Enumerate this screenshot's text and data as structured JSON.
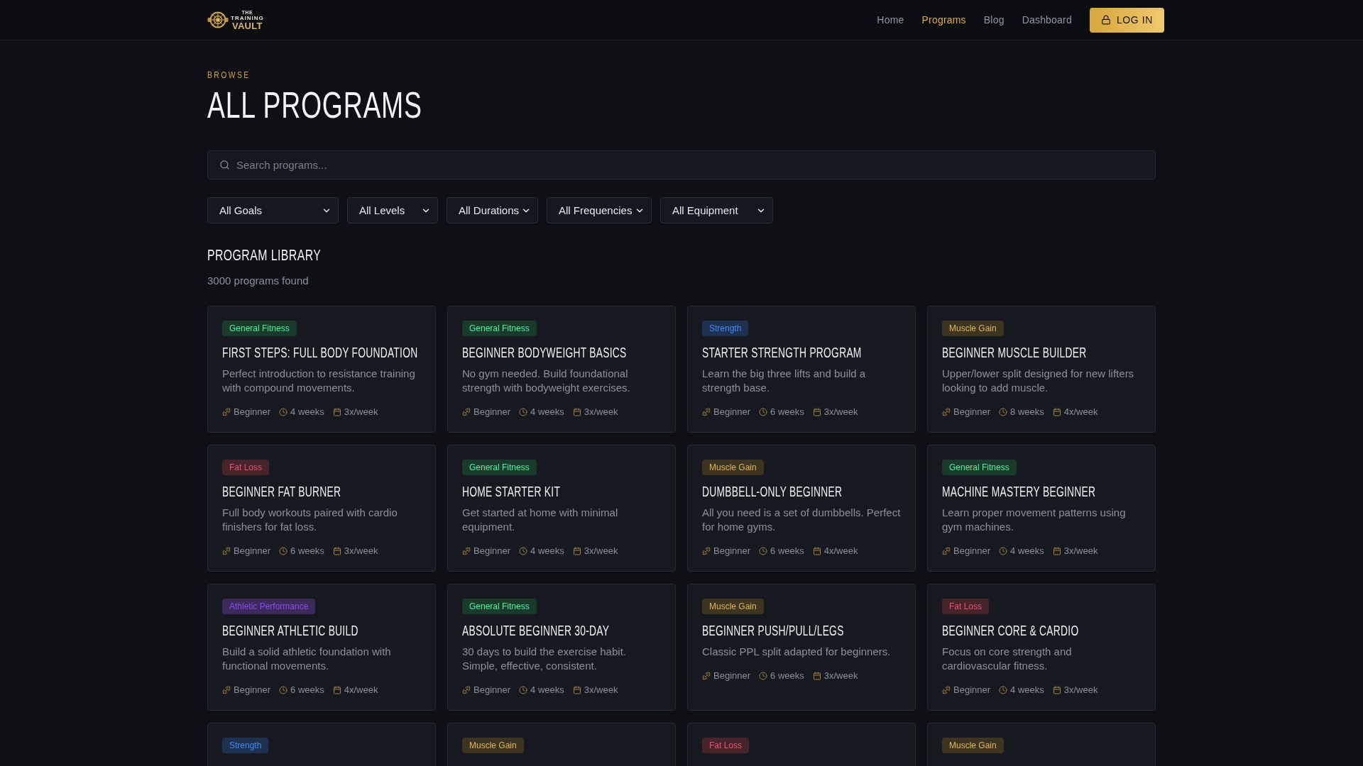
{
  "header": {
    "logo": {
      "line_1": "THE",
      "line_2": "TRAINING",
      "line_3": "VAULT"
    },
    "nav": [
      {
        "label": "Home",
        "selected": false
      },
      {
        "label": "Programs",
        "selected": true
      },
      {
        "label": "Blog",
        "selected": false
      },
      {
        "label": "Dashboard",
        "selected": false
      }
    ],
    "login_button": "LOG IN"
  },
  "page": {
    "eyebrow": "BROWSE",
    "title": "ALL PROGRAMS"
  },
  "search": {
    "placeholder": "Search programs..."
  },
  "filters": [
    "All Goals",
    "All Levels",
    "All Durations",
    "All Frequencies",
    "All Equipment"
  ],
  "library": {
    "heading": "PROGRAM LIBRARY",
    "count": "3000 programs found"
  },
  "cards": [
    {
      "tag": {
        "label": "General Fitness",
        "color": "#1a3b2b"
      },
      "title": "FIRST STEPS: FULL BODY FOUNDATION",
      "description": [
        "Perfect introduction to resistance training",
        "with compound movements."
      ],
      "difficulty": "Beginner",
      "duration": "4 weeks",
      "frequency": "3x/week"
    },
    {
      "tag": {
        "label": "General Fitness",
        "color": "#1a3b2b"
      },
      "title": "BEGINNER BODYWEIGHT BASICS",
      "description": [
        "No gym needed. Build foundational",
        "strength with bodyweight exercises."
      ],
      "difficulty": "Beginner",
      "duration": "4 weeks",
      "frequency": "3x/week"
    },
    {
      "tag": {
        "label": "Strength",
        "color": "#1e3150"
      },
      "title": "STARTER STRENGTH PROGRAM",
      "description": [
        "Learn the big three lifts and build a",
        "strength base."
      ],
      "difficulty": "Beginner",
      "duration": "6 weeks",
      "frequency": "3x/week"
    },
    {
      "tag": {
        "label": "Muscle Gain",
        "color": "#3d3421"
      },
      "title": "BEGINNER MUSCLE BUILDER",
      "description": [
        "Upper/lower split designed for new lifters",
        "looking to add muscle."
      ],
      "difficulty": "Beginner",
      "duration": "8 weeks",
      "frequency": "4x/week"
    },
    {
      "tag": {
        "label": "Fat Loss",
        "color": "#47242a"
      },
      "title": "BEGINNER FAT BURNER",
      "description": [
        "Full body workouts paired with cardio",
        "finishers for fat loss."
      ],
      "difficulty": "Beginner",
      "duration": "6 weeks",
      "frequency": "3x/week"
    },
    {
      "tag": {
        "label": "General Fitness",
        "color": "#1a3b2b"
      },
      "title": "HOME STARTER KIT",
      "description": [
        "Get started at home with minimal",
        "equipment."
      ],
      "difficulty": "Beginner",
      "duration": "4 weeks",
      "frequency": "3x/week"
    },
    {
      "tag": {
        "label": "Muscle Gain",
        "color": "#3d3421"
      },
      "title": "DUMBBELL-ONLY BEGINNER",
      "description": [
        "All you need is a set of dumbbells. Perfect",
        "for home gyms."
      ],
      "difficulty": "Beginner",
      "duration": "6 weeks",
      "frequency": "4x/week"
    },
    {
      "tag": {
        "label": "General Fitness",
        "color": "#1a3b2b"
      },
      "title": "MACHINE MASTERY BEGINNER",
      "description": [
        "Learn proper movement patterns using",
        "gym machines."
      ],
      "difficulty": "Beginner",
      "duration": "4 weeks",
      "frequency": "3x/week"
    },
    {
      "tag": {
        "label": "Athletic Performance",
        "color": "#3b2a5a"
      },
      "title": "BEGINNER ATHLETIC BUILD",
      "description": [
        "Build a solid athletic foundation with",
        "functional movements."
      ],
      "difficulty": "Beginner",
      "duration": "6 weeks",
      "frequency": "4x/week"
    },
    {
      "tag": {
        "label": "General Fitness",
        "color": "#1a3b2b"
      },
      "title": "ABSOLUTE BEGINNER 30-DAY",
      "description": [
        "30 days to build the exercise habit.",
        "Simple, effective, consistent."
      ],
      "difficulty": "Beginner",
      "duration": "4 weeks",
      "frequency": "3x/week"
    },
    {
      "tag": {
        "label": "Muscle Gain",
        "color": "#3d3421"
      },
      "title": "BEGINNER PUSH/PULL/LEGS",
      "description": [
        "Classic PPL split adapted for beginners."
      ],
      "difficulty": "Beginner",
      "duration": "6 weeks",
      "frequency": "3x/week"
    },
    {
      "tag": {
        "label": "Fat Loss",
        "color": "#47242a"
      },
      "title": "BEGINNER CORE & CARDIO",
      "description": [
        "Focus on core strength and",
        "cardiovascular fitness."
      ],
      "difficulty": "Beginner",
      "duration": "4 weeks",
      "frequency": "3x/week"
    },
    {
      "tag": {
        "label": "Strength",
        "color": "#1e3150"
      }
    },
    {
      "tag": {
        "label": "Muscle Gain",
        "color": "#3d3421"
      }
    },
    {
      "tag": {
        "label": "Fat Loss",
        "color": "#47242a"
      }
    },
    {
      "tag": {
        "label": "Muscle Gain",
        "color": "#3d3421"
      }
    }
  ]
}
